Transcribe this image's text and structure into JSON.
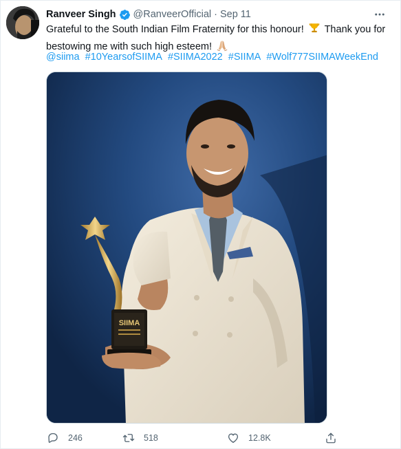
{
  "tweet": {
    "display_name": "Ranveer Singh",
    "handle": "@RanveerOfficial",
    "separator": "·",
    "date": "Sep 11",
    "text_part1": "Grateful to the South Indian Film Fraternity for this honour!",
    "text_part2": "Thank you for bestowing me with such high esteem!",
    "hashtags": [
      "@siima",
      "#10YearsofSIIMA",
      "#SIIMA2022",
      "#SIIMA",
      "#Wolf777SIIMAWeekEnd"
    ],
    "trophy_label": "SIIMA"
  },
  "icons": {
    "verified": "verified-badge-icon",
    "more": "more-dots-icon",
    "trophy_emoji": "trophy-emoji",
    "pray_emoji": "folded-hands-emoji",
    "reply": "reply-icon",
    "retweet": "retweet-icon",
    "like": "heart-icon",
    "share": "share-icon"
  },
  "actions": {
    "reply_count": "246",
    "retweet_count": "518",
    "like_count": "12.8K"
  },
  "colors": {
    "link": "#1d9bf0",
    "secondary": "#536471",
    "verified": "#1d9bf0",
    "photo_background": "#1c3a66"
  }
}
